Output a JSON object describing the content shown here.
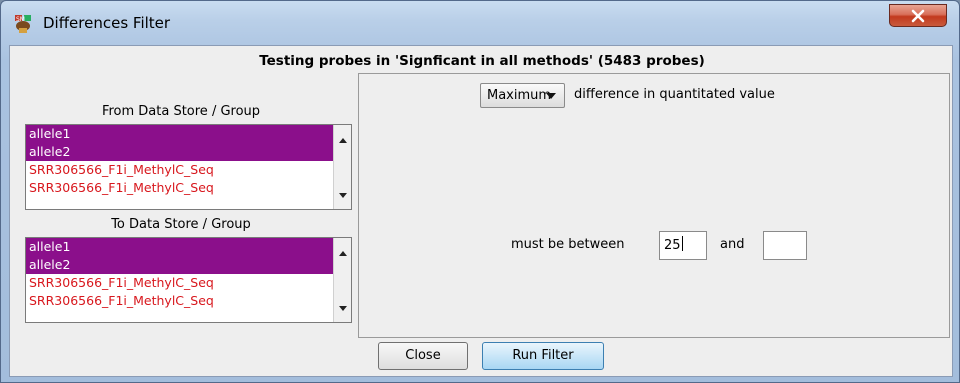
{
  "window": {
    "title": "Differences Filter",
    "app_icon": "seqmonk-app-icon",
    "close_icon": "close-x-icon"
  },
  "heading": "Testing probes in 'Signficant in all methods' (5483 probes)",
  "from_store": {
    "label": "From Data Store / Group",
    "items": [
      {
        "text": "allele1",
        "selected": true
      },
      {
        "text": "allele2",
        "selected": true
      },
      {
        "text": "SRR306566_F1i_MethylC_Seq",
        "selected": false
      },
      {
        "text": "SRR306566_F1i_MethylC_Seq",
        "selected": false
      }
    ]
  },
  "to_store": {
    "label": "To Data Store / Group",
    "items": [
      {
        "text": "allele1",
        "selected": true
      },
      {
        "text": "allele2",
        "selected": true
      },
      {
        "text": "SRR306566_F1i_MethylC_Seq",
        "selected": false
      },
      {
        "text": "SRR306566_F1i_MethylC_Seq",
        "selected": false
      }
    ]
  },
  "options": {
    "combo_value": "Maximum",
    "difference_label": "difference in quantitated value",
    "between_label": "must be between",
    "lower_value": "25",
    "and_label": "and",
    "upper_value": ""
  },
  "buttons": {
    "close_label": "Close",
    "run_label": "Run Filter"
  },
  "colors": {
    "selected_bg": "#8b0f8b",
    "unselected_text": "#d8171d"
  }
}
